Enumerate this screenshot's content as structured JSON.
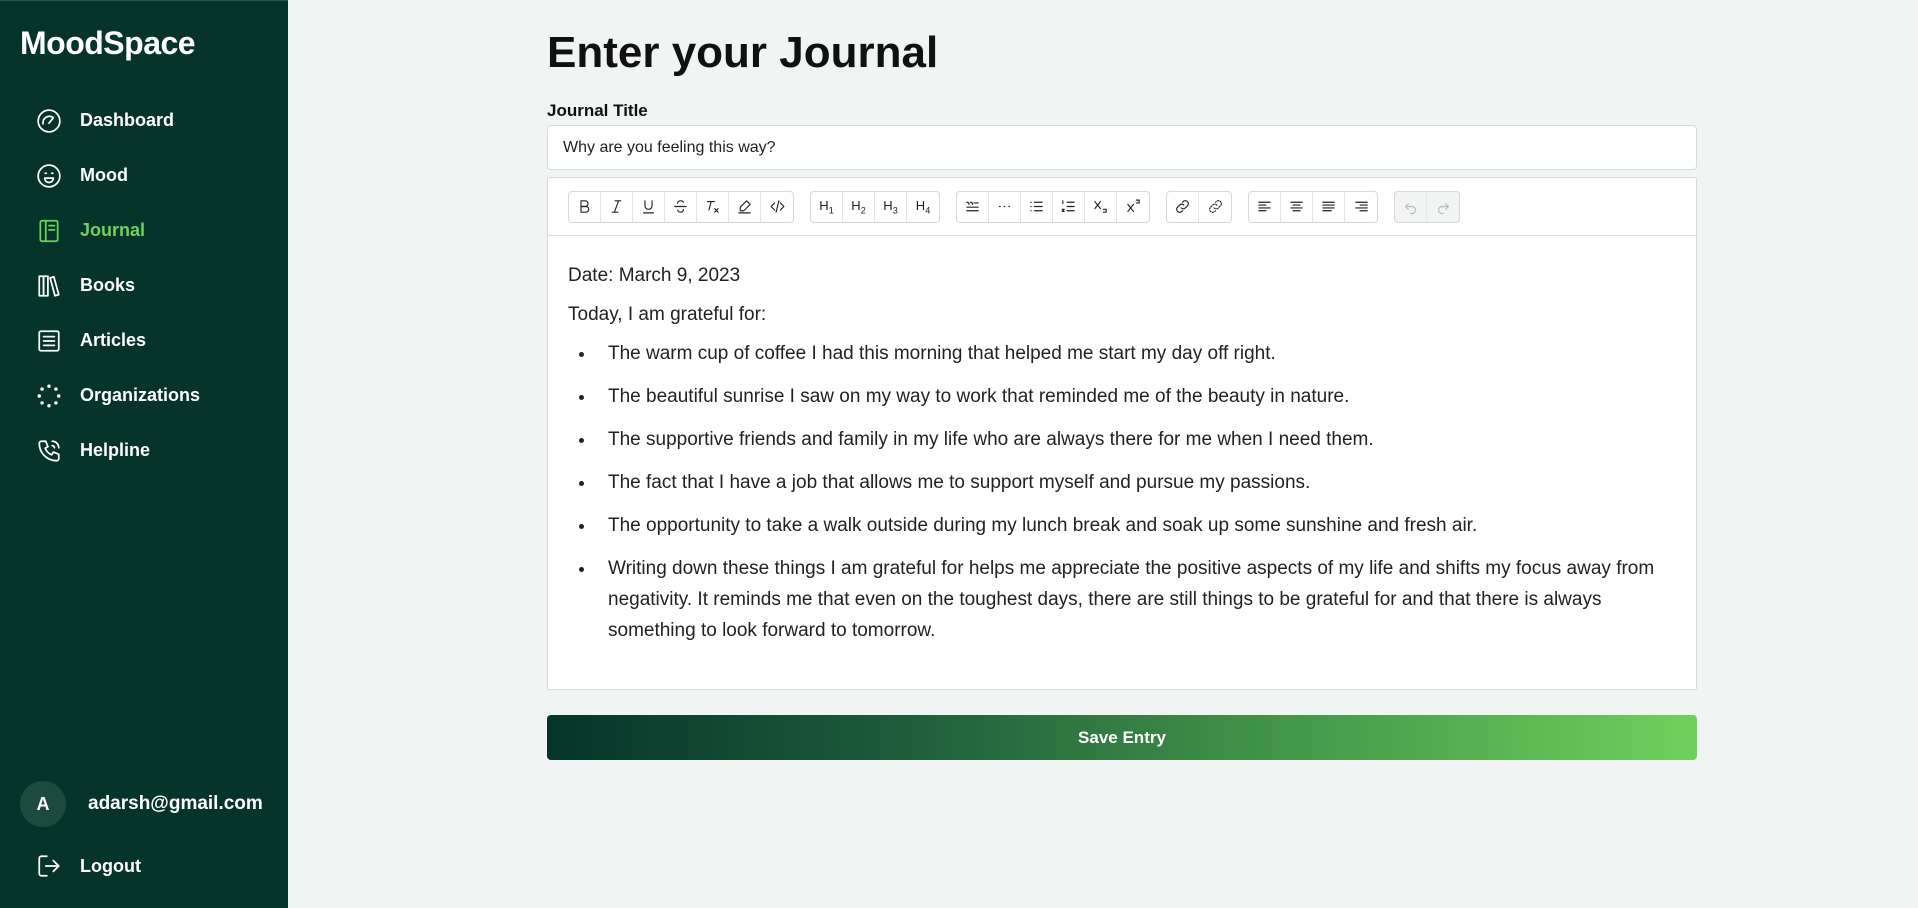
{
  "app": {
    "title": "MoodSpace"
  },
  "sidebar": {
    "items": [
      {
        "label": "Dashboard",
        "icon": "gauge-icon",
        "active": false
      },
      {
        "label": "Mood",
        "icon": "smiley-icon",
        "active": false
      },
      {
        "label": "Journal",
        "icon": "notebook-icon",
        "active": true
      },
      {
        "label": "Books",
        "icon": "books-icon",
        "active": false
      },
      {
        "label": "Articles",
        "icon": "article-icon",
        "active": false
      },
      {
        "label": "Organizations",
        "icon": "dots-circle-icon",
        "active": false
      },
      {
        "label": "Helpline",
        "icon": "phone-icon",
        "active": false
      }
    ],
    "user": {
      "initial": "A",
      "email": "adarsh@gmail.com"
    },
    "logout_label": "Logout"
  },
  "main": {
    "page_title": "Enter your Journal",
    "title_field_label": "Journal Title",
    "title_value": "Why are you feeling this way?",
    "toolbar": {
      "format": [
        "B",
        "I",
        "U",
        "S",
        "Tx",
        "highlight",
        "code"
      ],
      "headings": [
        "H1",
        "H2",
        "H3",
        "H4"
      ],
      "blocks": [
        "blockquote",
        "horizontal-rule",
        "bullet-list",
        "ordered-list",
        "subscript",
        "superscript"
      ],
      "links": [
        "link",
        "unlink"
      ],
      "align": [
        "align-left",
        "align-center",
        "align-justify",
        "align-right"
      ],
      "history": [
        "undo",
        "redo"
      ]
    },
    "editor": {
      "date_line": "Date: March 9, 2023",
      "intro_line": "Today, I am grateful for:",
      "items": [
        "The warm cup of coffee I had this morning that helped me start my day off right.",
        "The beautiful sunrise I saw on my way to work that reminded me of the beauty in nature.",
        "The supportive friends and family in my life who are always there for me when I need them.",
        "The fact that I have a job that allows me to support myself and pursue my passions.",
        "The opportunity to take a walk outside during my lunch break and soak up some sunshine and fresh air.",
        "Writing down these things I am grateful for helps me appreciate the positive aspects of my life and shifts my focus away from negativity. It reminds me that even on the toughest days, there are still things to be grateful for and that there is always something to look forward to tomorrow."
      ]
    },
    "save_label": "Save Entry"
  },
  "colors": {
    "sidebar_bg": "#06342a",
    "accent": "#6fd15c",
    "page_bg": "#f0f5f4"
  }
}
